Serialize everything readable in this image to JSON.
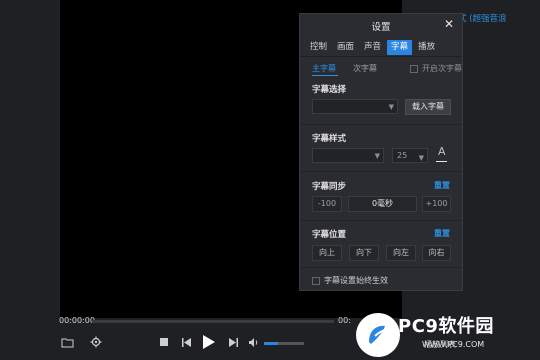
{
  "right_panel": {
    "link_text": "式 (超强音浪"
  },
  "player": {
    "time_current": "00:00:00",
    "time_total": "00:",
    "progress_fraction": 0.0,
    "volume_fraction": 0.35,
    "bottom_right_text": "插放列表"
  },
  "settings": {
    "title": "设置",
    "close_glyph": "✕",
    "tabs": [
      {
        "label": "控制",
        "active": false
      },
      {
        "label": "画面",
        "active": false
      },
      {
        "label": "声音",
        "active": false
      },
      {
        "label": "字幕",
        "active": true
      },
      {
        "label": "播放",
        "active": false
      }
    ],
    "subtabs": {
      "primary": "主字幕",
      "secondary": "次字幕",
      "enable_secondary": "开启次字幕"
    },
    "subtitle_select": {
      "label": "字幕选择",
      "select_value": "",
      "load_button": "载入字幕"
    },
    "subtitle_style": {
      "label": "字幕样式",
      "font_value": "",
      "size_value": "25",
      "color_glyph": "A"
    },
    "subtitle_sync": {
      "label": "字幕同步",
      "reset": "重置",
      "minus": "-100",
      "value": "0毫秒",
      "plus": "+100"
    },
    "subtitle_position": {
      "label": "字幕位置",
      "reset": "重置",
      "buttons": [
        "向上",
        "向下",
        "向左",
        "向右"
      ]
    },
    "always_effective": "字幕设置始终生效"
  },
  "watermark": {
    "title": "PC9软件园",
    "subtitle": "WWW.PC9.COM"
  },
  "colors": {
    "accent": "#2a86e0",
    "panel_bg": "#2b2c31",
    "app_bg": "#1e1f22"
  }
}
